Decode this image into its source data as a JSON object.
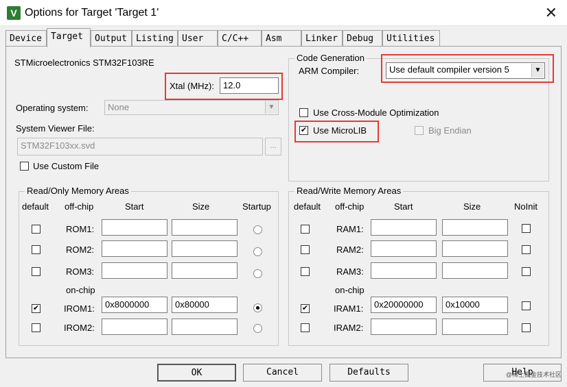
{
  "window": {
    "title": "Options for Target 'Target 1'",
    "icon_letter": "V"
  },
  "tabs": [
    {
      "label": "Device"
    },
    {
      "label": "Target"
    },
    {
      "label": "Output"
    },
    {
      "label": "Listing"
    },
    {
      "label": "User"
    },
    {
      "label": "C/C++"
    },
    {
      "label": "Asm"
    },
    {
      "label": "Linker"
    },
    {
      "label": "Debug"
    },
    {
      "label": "Utilities"
    }
  ],
  "target": {
    "device": "STMicroelectronics STM32F103RE",
    "xtal_label": "Xtal (MHz):",
    "xtal_value": "12.0",
    "os_label": "Operating system:",
    "os_value": "None",
    "svd_label": "System Viewer File:",
    "svd_value": "STM32F103xx.svd",
    "browse": "...",
    "custom_file": "Use Custom File"
  },
  "codegen": {
    "legend": "Code Generation",
    "compiler_label": "ARM Compiler:",
    "compiler_value": "Use default compiler version 5",
    "cross_module": "Use Cross-Module Optimization",
    "microlib": "Use MicroLIB",
    "big_endian": "Big Endian"
  },
  "rom": {
    "legend": "Read/Only Memory Areas",
    "headers": {
      "default": "default",
      "offchip": "off-chip",
      "start": "Start",
      "size": "Size",
      "startup": "Startup"
    },
    "onchip": "on-chip",
    "rows": [
      {
        "label": "ROM1:",
        "start": "",
        "size": ""
      },
      {
        "label": "ROM2:",
        "start": "",
        "size": ""
      },
      {
        "label": "ROM3:",
        "start": "",
        "size": ""
      },
      {
        "label": "IROM1:",
        "start": "0x8000000",
        "size": "0x80000"
      },
      {
        "label": "IROM2:",
        "start": "",
        "size": ""
      }
    ]
  },
  "ram": {
    "legend": "Read/Write Memory Areas",
    "headers": {
      "default": "default",
      "offchip": "off-chip",
      "start": "Start",
      "size": "Size",
      "noinit": "NoInit"
    },
    "onchip": "on-chip",
    "rows": [
      {
        "label": "RAM1:",
        "start": "",
        "size": ""
      },
      {
        "label": "RAM2:",
        "start": "",
        "size": ""
      },
      {
        "label": "RAM3:",
        "start": "",
        "size": ""
      },
      {
        "label": "IRAM1:",
        "start": "0x20000000",
        "size": "0x10000"
      },
      {
        "label": "IRAM2:",
        "start": "",
        "size": ""
      }
    ]
  },
  "buttons": {
    "ok": "OK",
    "cancel": "Cancel",
    "defaults": "Defaults",
    "help": "Help"
  },
  "watermark": "@稀土掘金技术社区"
}
